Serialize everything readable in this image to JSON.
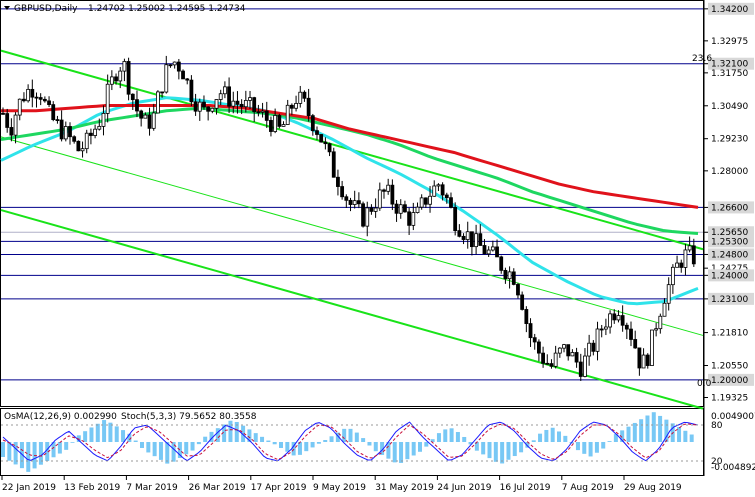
{
  "header": {
    "symbol_label": "GBPUSD,Daily",
    "ohlc": "1.24702 1.25002 1.24595 1.24734"
  },
  "indicator_header": {
    "osma_label": "OsMA(12,26,9) 0.002990",
    "stoch_label": "Stoch(5,3,3) 79.5652 80.3558"
  },
  "fib_labels": {
    "top": "23.6",
    "bottom": "0.0"
  },
  "colors": {
    "candle": "#000000",
    "ma_red": "#e0121b",
    "ma_green": "#1ed760",
    "ma_cyan": "#2fe3ea",
    "channel": "#19e319",
    "level": "#00008b",
    "osma_bar": "#78c8f5",
    "stoch_main": "#1a1aff",
    "stoch_signal": "#c8103a"
  },
  "price_axis": [
    {
      "text": "1.34200",
      "hl": true,
      "p": 1.342
    },
    {
      "text": "1.32975",
      "hl": false,
      "p": 1.32975
    },
    {
      "text": "1.32100",
      "hl": true,
      "p": 1.321
    },
    {
      "text": "1.31750",
      "hl": false,
      "p": 1.3175
    },
    {
      "text": "1.30490",
      "hl": false,
      "p": 1.3049
    },
    {
      "text": "1.29230",
      "hl": false,
      "p": 1.2923
    },
    {
      "text": "1.28000",
      "hl": false,
      "p": 1.28
    },
    {
      "text": "1.26600",
      "hl": true,
      "p": 1.266
    },
    {
      "text": "1.25650",
      "hl": true,
      "p": 1.2565
    },
    {
      "text": "1.25300",
      "hl": true,
      "p": 1.253
    },
    {
      "text": "1.24800",
      "hl": true,
      "p": 1.248
    },
    {
      "text": "1.24275",
      "hl": false,
      "p": 1.24275
    },
    {
      "text": "1.24000",
      "hl": true,
      "p": 1.24
    },
    {
      "text": "1.23100",
      "hl": true,
      "p": 1.231
    },
    {
      "text": "1.21810",
      "hl": false,
      "p": 1.2181
    },
    {
      "text": "1.20550",
      "hl": false,
      "p": 1.2055
    },
    {
      "text": "1.20000",
      "hl": true,
      "p": 1.2
    },
    {
      "text": "1.19325",
      "hl": false,
      "p": 1.19325
    }
  ],
  "indicator_axis": [
    "0.0049007",
    "80",
    "20",
    "-0.004892"
  ],
  "date_axis": [
    "22 Jan 2019",
    "13 Feb 2019",
    "7 Mar 2019",
    "26 Mar 2019",
    "17 Apr 2019",
    "9 May 2019",
    "31 May 2019",
    "24 Jun 2019",
    "16 Jul 2019",
    "7 Aug 2019",
    "29 Aug 2019"
  ],
  "chart_data": {
    "type": "candlestick",
    "symbol": "GBPUSD",
    "timeframe": "Daily",
    "ylim": [
      1.19,
      1.345
    ],
    "horizontal_levels": [
      1.342,
      1.321,
      1.266,
      1.2565,
      1.253,
      1.248,
      1.24,
      1.231,
      1.2
    ],
    "close_path": [
      1.302,
      1.296,
      1.305,
      1.31,
      1.312,
      1.31,
      1.302,
      1.298,
      1.295,
      1.292,
      1.288,
      1.29,
      1.295,
      1.3,
      1.31,
      1.318,
      1.322,
      1.31,
      1.302,
      1.298,
      1.3,
      1.312,
      1.32,
      1.322,
      1.318,
      1.31,
      1.305,
      1.302,
      1.308,
      1.31,
      1.308,
      1.306,
      1.305,
      1.304,
      1.302,
      1.3,
      1.298,
      1.295,
      1.302,
      1.308,
      1.306,
      1.3,
      1.295,
      1.288,
      1.28,
      1.275,
      1.268,
      1.265,
      1.262,
      1.266,
      1.27,
      1.272,
      1.268,
      1.265,
      1.262,
      1.262,
      1.268,
      1.272,
      1.275,
      1.27,
      1.262,
      1.258,
      1.255,
      1.252,
      1.25,
      1.248,
      1.245,
      1.242,
      1.24,
      1.232,
      1.218,
      1.212,
      1.208,
      1.205,
      1.21,
      1.212,
      1.208,
      1.205,
      1.21,
      1.215,
      1.222,
      1.225,
      1.228,
      1.222,
      1.215,
      1.205,
      1.21,
      1.222,
      1.232,
      1.238,
      1.245,
      1.248,
      1.247
    ],
    "ma_red": [
      1.303,
      1.303,
      1.304,
      1.305,
      1.305,
      1.305,
      1.305,
      1.304,
      1.302,
      1.3,
      1.296,
      1.293,
      1.29,
      1.287,
      1.283,
      1.279,
      1.275,
      1.272,
      1.27,
      1.268,
      1.266
    ],
    "ma_green": [
      1.292,
      1.294,
      1.296,
      1.299,
      1.301,
      1.303,
      1.304,
      1.303,
      1.302,
      1.3,
      1.297,
      1.294,
      1.29,
      1.285,
      1.281,
      1.277,
      1.272,
      1.268,
      1.264,
      1.26,
      1.257,
      1.256
    ],
    "ma_cyan": [
      1.284,
      1.29,
      1.295,
      1.302,
      1.306,
      1.308,
      1.307,
      1.305,
      1.303,
      1.298,
      1.292,
      1.285,
      1.279,
      1.272,
      1.264,
      1.255,
      1.245,
      1.238,
      1.232,
      1.229,
      1.23,
      1.235
    ],
    "channel_lines": [
      {
        "from": [
          1.326,
          0
        ],
        "to": [
          1.25,
          1
        ]
      },
      {
        "from": [
          1.293,
          0
        ],
        "to": [
          1.217,
          1
        ]
      },
      {
        "from": [
          1.265,
          0
        ],
        "to": [
          1.189,
          1
        ]
      }
    ],
    "osma": [
      -2,
      -3,
      -4,
      -3,
      -2,
      -1,
      1,
      2,
      3,
      2,
      1,
      -1,
      -2,
      -3,
      -2,
      -1,
      1,
      2,
      3,
      2,
      1,
      0,
      -1,
      -2,
      -1,
      0,
      1,
      2,
      1,
      -1,
      -2,
      -3,
      -2,
      -1,
      1,
      2,
      1,
      -1,
      -2,
      -3,
      -2,
      -1,
      1,
      2,
      1,
      -1,
      -2,
      -1,
      1,
      2,
      3,
      4,
      3,
      2,
      1
    ],
    "stoch_main": [
      60,
      40,
      20,
      30,
      55,
      70,
      50,
      30,
      20,
      45,
      75,
      80,
      60,
      40,
      20,
      35,
      60,
      80,
      70,
      50,
      25,
      20,
      40,
      70,
      85,
      75,
      50,
      30,
      20,
      40,
      70,
      85,
      60,
      40,
      20,
      30,
      55,
      80,
      85,
      70,
      45,
      25,
      20,
      40,
      70,
      85,
      80,
      60,
      35,
      20,
      40,
      75,
      85,
      80
    ],
    "stoch_signal": [
      55,
      45,
      30,
      28,
      45,
      62,
      55,
      38,
      25,
      38,
      65,
      78,
      68,
      48,
      28,
      30,
      50,
      72,
      72,
      56,
      32,
      22,
      35,
      60,
      80,
      78,
      58,
      36,
      24,
      35,
      60,
      80,
      66,
      46,
      26,
      28,
      48,
      72,
      82,
      74,
      52,
      32,
      22,
      36,
      62,
      80,
      80,
      64,
      42,
      25,
      36,
      66,
      82,
      80
    ]
  }
}
